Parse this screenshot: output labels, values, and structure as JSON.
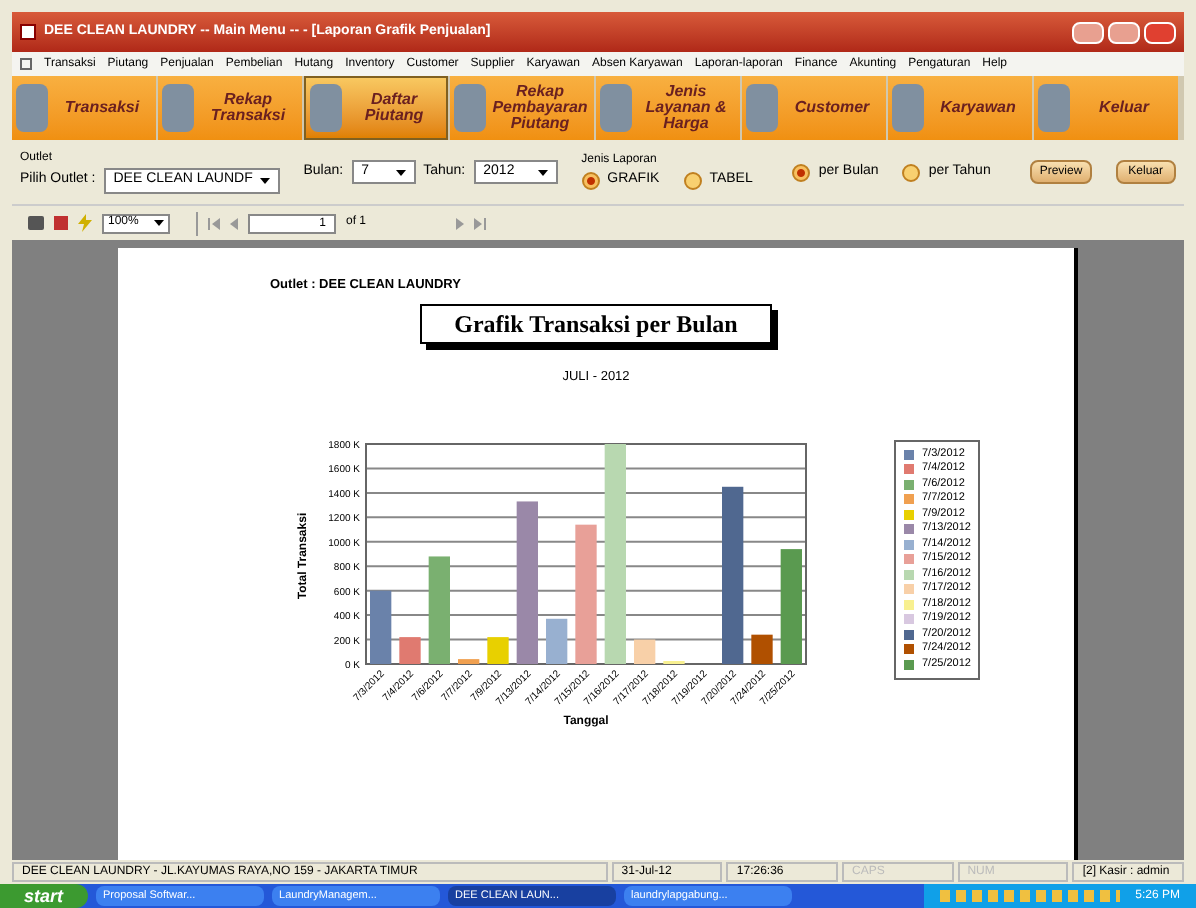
{
  "window": {
    "title": "DEE CLEAN LAUNDRY -- Main Menu -- - [Laporan Grafik Penjualan]"
  },
  "menu": [
    "Transaksi",
    "Piutang",
    "Penjualan",
    "Pembelian",
    "Hutang",
    "Inventory",
    "Customer",
    "Supplier",
    "Karyawan",
    "Absen Karyawan",
    "Laporan-laporan",
    "Finance",
    "Akunting",
    "Pengaturan",
    "Help"
  ],
  "toolbar": [
    {
      "label": "Transaksi",
      "selected": false
    },
    {
      "label": "Rekap Transaksi",
      "selected": false
    },
    {
      "label": "Daftar Piutang",
      "selected": true
    },
    {
      "label": "Rekap Pembayaran Piutang",
      "selected": false
    },
    {
      "label": "Jenis Layanan & Harga",
      "selected": false
    },
    {
      "label": "Customer",
      "selected": false
    },
    {
      "label": "Karyawan",
      "selected": false
    },
    {
      "label": "Keluar",
      "selected": false
    }
  ],
  "filters": {
    "outlet_group": "Outlet",
    "outlet_label": "Pilih Outlet :",
    "outlet_value": "DEE CLEAN LAUNDF",
    "bulan_label": "Bulan:",
    "bulan_value": "7",
    "tahun_label": "Tahun:",
    "tahun_value": "2012",
    "jenis_label": "Jenis Laporan",
    "jenis": [
      {
        "label": "GRAFIK",
        "selected": true
      },
      {
        "label": "TABEL",
        "selected": false
      }
    ],
    "period": [
      {
        "label": "per Bulan",
        "selected": true
      },
      {
        "label": "per Tahun",
        "selected": false
      }
    ],
    "buttons": [
      "Preview",
      "Keluar"
    ]
  },
  "viewer": {
    "zoom": "100%",
    "page": "1",
    "of": "of 1"
  },
  "report": {
    "outlet": "Outlet : DEE CLEAN LAUNDRY",
    "title": "Grafik Transaksi per Bulan",
    "subtitle": "JULI - 2012",
    "chart_data": {
      "type": "bar",
      "xlabel": "Tanggal",
      "ylabel": "Total Transaksi",
      "categories": [
        "7/3/2012",
        "7/4/2012",
        "7/6/2012",
        "7/7/2012",
        "7/9/2012",
        "7/13/2012",
        "7/14/2012",
        "7/15/2012",
        "7/16/2012",
        "7/17/2012",
        "7/18/2012",
        "7/19/2012",
        "7/20/2012",
        "7/24/2012",
        "7/25/2012"
      ],
      "values": [
        600000,
        220000,
        880000,
        40000,
        220000,
        1330000,
        370000,
        1140000,
        1800000,
        200000,
        20000,
        0,
        1450000,
        240000,
        940000
      ],
      "grid": true,
      "ylim": [
        0,
        1800000
      ],
      "yticks": [
        {
          "value": 0,
          "label": "0 K"
        },
        {
          "value": 200000,
          "label": "200 K"
        },
        {
          "value": 400000,
          "label": "400 K"
        },
        {
          "value": 600000,
          "label": "600 K"
        },
        {
          "value": 800000,
          "label": "800 K"
        },
        {
          "value": 1000000,
          "label": "1000 K"
        },
        {
          "value": 1200000,
          "label": "1200 K"
        },
        {
          "value": 1400000,
          "label": "1400 K"
        },
        {
          "value": 1600000,
          "label": "1600 K"
        },
        {
          "value": 1800000,
          "label": "1800 K"
        }
      ]
    },
    "legend": [
      {
        "label": "7/3/2012",
        "color": "#6a82aa"
      },
      {
        "label": "7/4/2012",
        "color": "#e07a70"
      },
      {
        "label": "7/6/2012",
        "color": "#7ab070"
      },
      {
        "label": "7/7/2012",
        "color": "#f0a050"
      },
      {
        "label": "7/9/2012",
        "color": "#e8d000"
      },
      {
        "label": "7/13/2012",
        "color": "#9a88a8"
      },
      {
        "label": "7/14/2012",
        "color": "#98b0d0"
      },
      {
        "label": "7/15/2012",
        "color": "#e8a098"
      },
      {
        "label": "7/16/2012",
        "color": "#b8d8b0"
      },
      {
        "label": "7/17/2012",
        "color": "#f8d0a8"
      },
      {
        "label": "7/18/2012",
        "color": "#f8f090"
      },
      {
        "label": "7/19/2012",
        "color": "#d8c8e0"
      },
      {
        "label": "7/20/2012",
        "color": "#506890"
      },
      {
        "label": "7/24/2012",
        "color": "#b05000"
      },
      {
        "label": "7/25/2012",
        "color": "#5a9a50"
      }
    ]
  },
  "status_bar": [
    "DEE CLEAN LAUNDRY - JL.KAYUMAS RAYA,NO 159 - JAKARTA TIMUR",
    "31-Jul-12",
    "17:26:36",
    "CAPS",
    "NUM",
    "[2] Kasir : admin"
  ],
  "taskbar": {
    "start": "start",
    "tasks": [
      {
        "label": "Proposal Softwar...",
        "selected": false
      },
      {
        "label": "LaundryManagem...",
        "selected": false
      },
      {
        "label": "DEE CLEAN LAUN...",
        "selected": true
      },
      {
        "label": "laundrylapgabung...",
        "selected": false
      }
    ],
    "clock": "5:26 PM"
  }
}
